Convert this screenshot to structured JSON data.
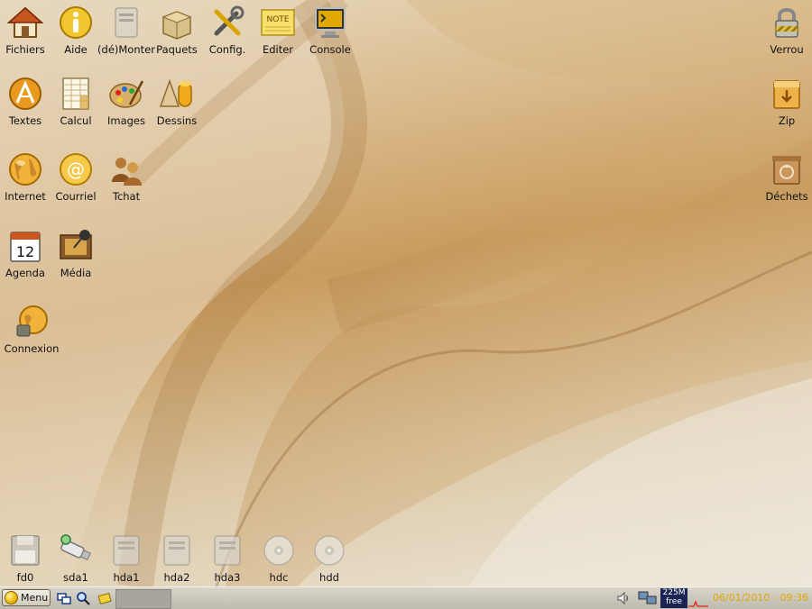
{
  "desktop": {
    "icons_left": [
      {
        "label": "Fichiers",
        "icon": "home-folder-icon"
      },
      {
        "label": "Aide",
        "icon": "info-icon"
      },
      {
        "label": "(dé)Monter",
        "icon": "drive-icon"
      },
      {
        "label": "Paquets",
        "icon": "package-icon"
      },
      {
        "label": "Config.",
        "icon": "tools-icon"
      },
      {
        "label": "Editer",
        "icon": "note-icon"
      },
      {
        "label": "Console",
        "icon": "terminal-icon"
      },
      {
        "label": "Textes",
        "icon": "text-editor-icon"
      },
      {
        "label": "Calcul",
        "icon": "spreadsheet-icon"
      },
      {
        "label": "Images",
        "icon": "palette-icon"
      },
      {
        "label": "Dessins",
        "icon": "shapes-icon"
      },
      {
        "label": "Internet",
        "icon": "globe-icon"
      },
      {
        "label": "Courriel",
        "icon": "email-icon"
      },
      {
        "label": "Tchat",
        "icon": "chat-icon"
      },
      {
        "label": "Agenda",
        "icon": "calendar-icon"
      },
      {
        "label": "Média",
        "icon": "media-icon"
      },
      {
        "label": "Connexion",
        "icon": "connect-icon"
      }
    ],
    "icons_right": [
      {
        "label": "Verrou",
        "icon": "lock-icon"
      },
      {
        "label": "Zip",
        "icon": "zip-box-icon"
      },
      {
        "label": "Déchets",
        "icon": "trash-icon"
      }
    ],
    "drives": [
      {
        "label": "fd0",
        "icon": "floppy-icon"
      },
      {
        "label": "sda1",
        "icon": "usb-drive-icon"
      },
      {
        "label": "hda1",
        "icon": "hard-drive-icon"
      },
      {
        "label": "hda2",
        "icon": "hard-drive-icon"
      },
      {
        "label": "hda3",
        "icon": "hard-drive-icon"
      },
      {
        "label": "hdc",
        "icon": "cdrom-icon"
      },
      {
        "label": "hdd",
        "icon": "cdrom-icon"
      }
    ],
    "calendar_day": "12",
    "note_text": "NOTE"
  },
  "taskbar": {
    "menu_label": "Menu",
    "memory_line1": "225M",
    "memory_line2": "free",
    "clock": "06/01/2010 - 09:36"
  },
  "colors": {
    "clock": "#e0a800",
    "memory_bg": "#1b2352",
    "wallpaper_accent": "#c99c5e"
  }
}
